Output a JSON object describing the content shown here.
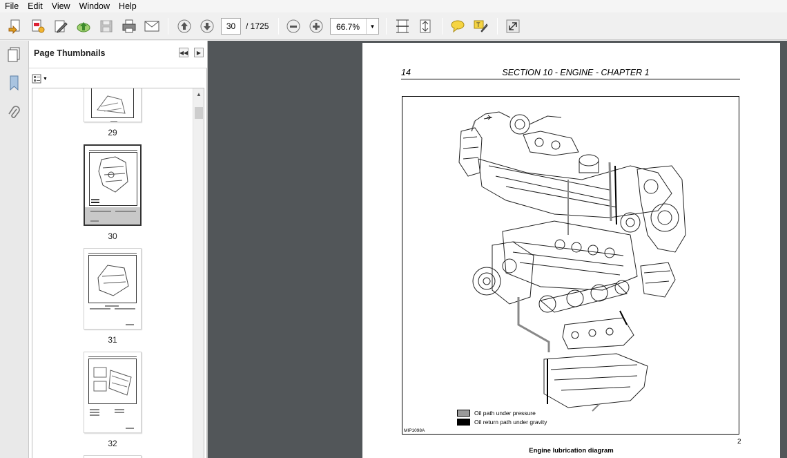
{
  "menu": {
    "items": [
      "File",
      "Edit",
      "View",
      "Window",
      "Help"
    ]
  },
  "toolbar": {
    "current_page": "30",
    "page_total": "/  1725",
    "zoom": "66.7%",
    "icons": [
      "create-icon",
      "convert-icon",
      "edit-icon",
      "upload-icon",
      "save-icon",
      "print-icon",
      "email-icon",
      "previous-page-icon",
      "next-page-icon",
      "zoom-out-icon",
      "zoom-in-icon",
      "fit-width-icon",
      "fit-page-icon",
      "comment-icon",
      "highlight-icon",
      "expand-icon"
    ]
  },
  "sidebar": {
    "title": "Page Thumbnails",
    "thumbnails": [
      {
        "label": "29",
        "selected": false
      },
      {
        "label": "30",
        "selected": true
      },
      {
        "label": "31",
        "selected": false
      },
      {
        "label": "32",
        "selected": false
      }
    ]
  },
  "document": {
    "page_number": "14",
    "section_title": "SECTION 10 - ENGINE - CHAPTER 1",
    "legend": [
      {
        "label": "Oil path under pressure",
        "color": "#9a9a9a"
      },
      {
        "label": "Oil return path under gravity",
        "color": "#000000"
      }
    ],
    "figure_code": "MIP1098A",
    "figure_number": "2",
    "caption": "Engine lubrication diagram"
  },
  "colors": {
    "doc_background": "#525659",
    "panel_background": "#ffffff",
    "toolbar_background": "#f0f0f0"
  }
}
